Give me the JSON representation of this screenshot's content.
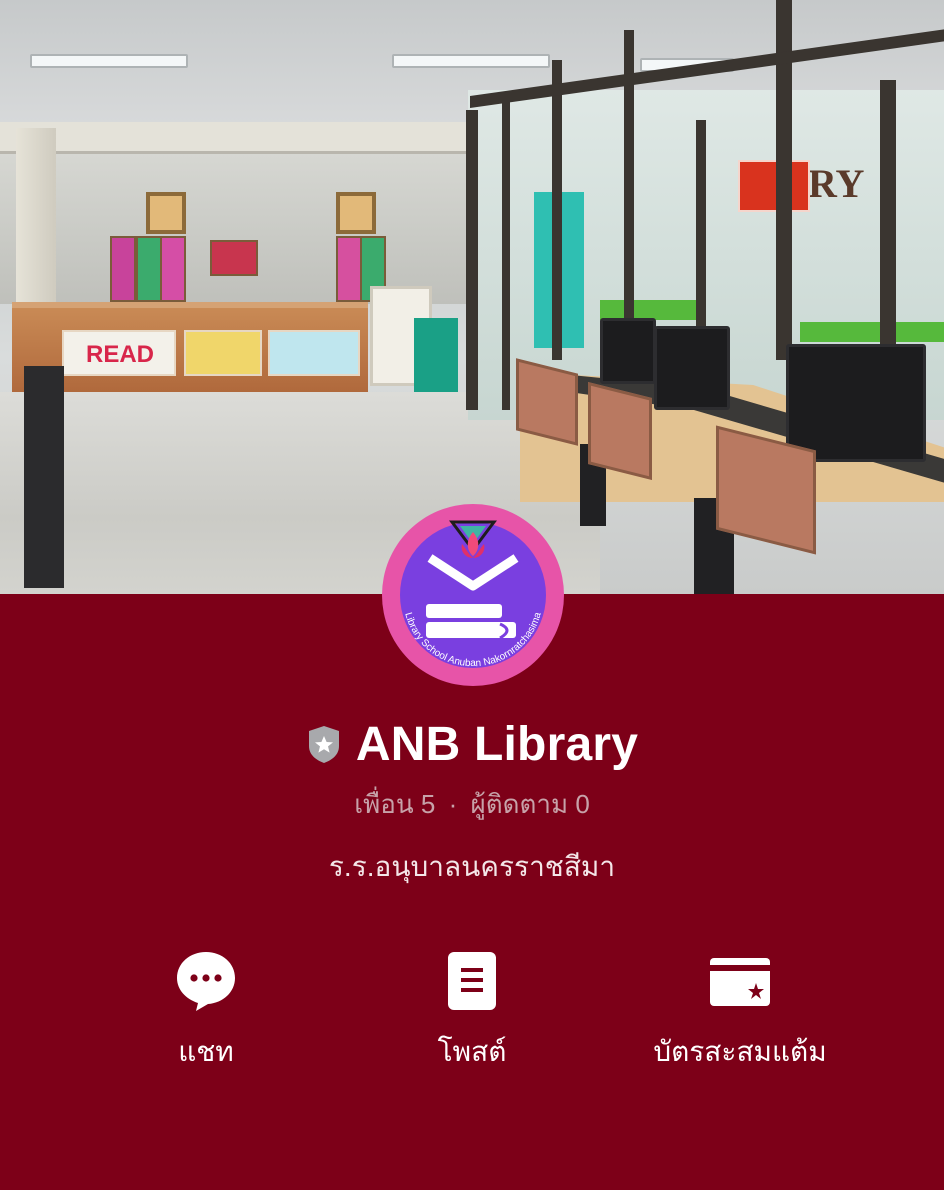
{
  "profile": {
    "name": "ANB Library",
    "friends_label": "เพื่อน 5",
    "followers_label": "ผู้ติดตาม 0",
    "separator": "·",
    "status_message": "ร.ร.อนุบาลนครราชสีมา",
    "badge_icon": "shield-star-icon",
    "logo_text": "Library School Anuban Nakornratchasima"
  },
  "actions": [
    {
      "label": "แชท",
      "icon": "chat-bubble-icon"
    },
    {
      "label": "โพสต์",
      "icon": "post-document-icon"
    },
    {
      "label": "บัตรสะสมแต้ม",
      "icon": "reward-card-icon"
    }
  ],
  "cover": {
    "sign_text": "READ",
    "library_sign_text": "RY"
  },
  "colors": {
    "background": "#7d0018",
    "logo_outer": "#e754a8",
    "logo_inner": "#7a3fe0",
    "text_primary": "#ffffff",
    "text_muted": "#c7a2a9"
  }
}
